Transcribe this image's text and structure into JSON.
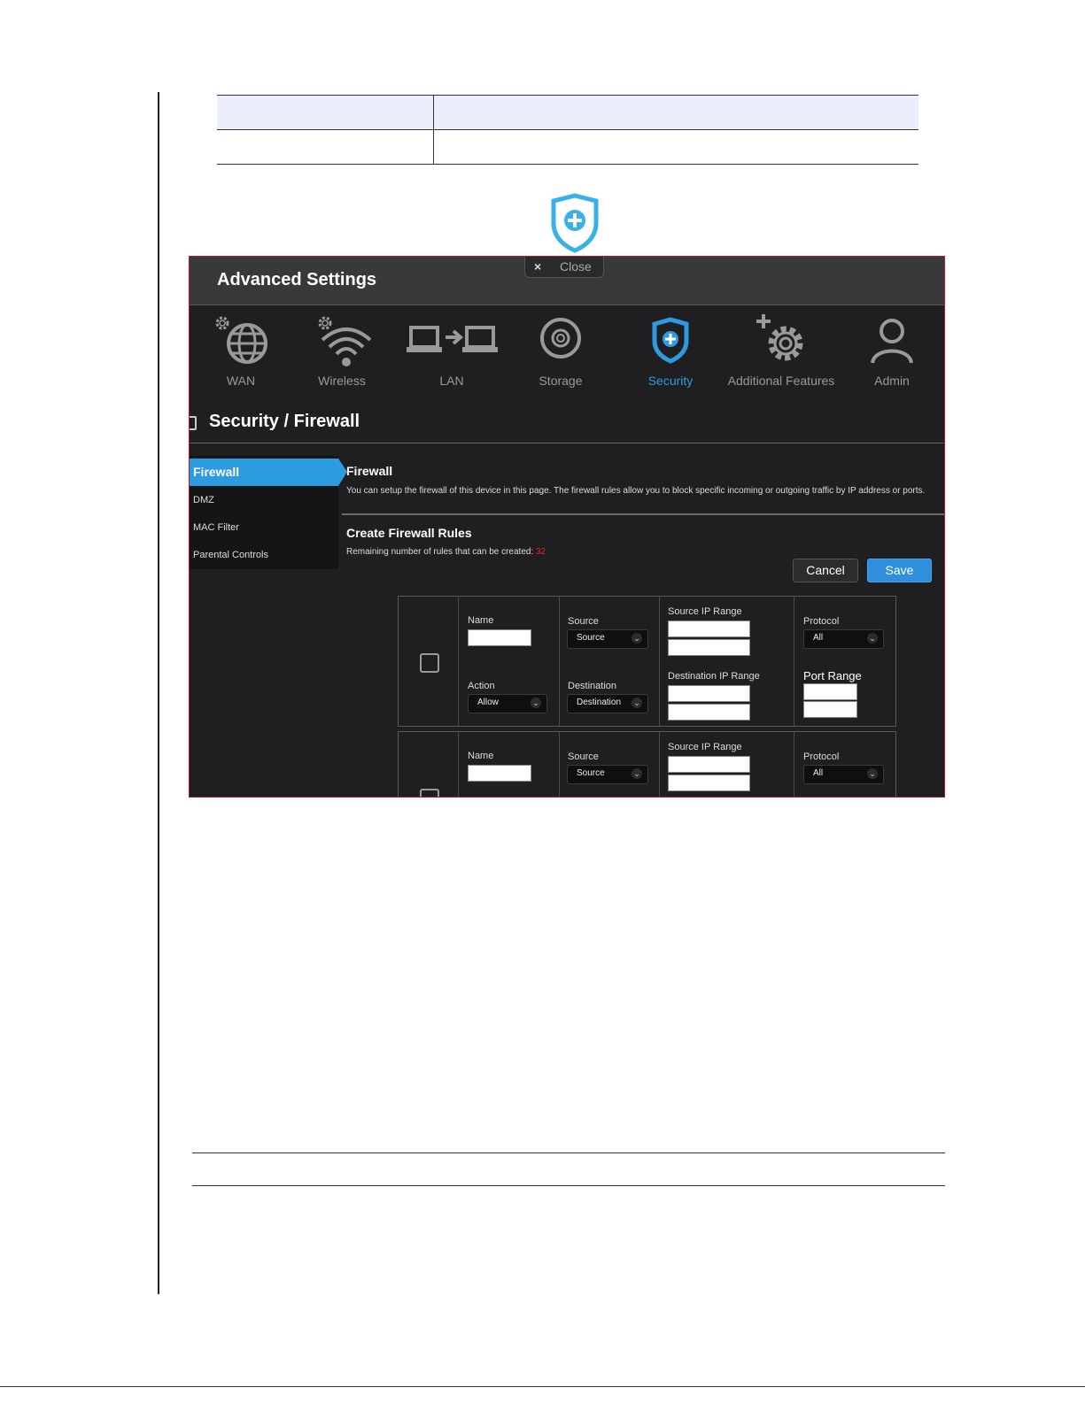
{
  "app": {
    "title": "Advanced Settings",
    "close_label": "Close",
    "close_icon": "×"
  },
  "nav": {
    "items": [
      {
        "label": "WAN",
        "icon": "globe-gear-icon"
      },
      {
        "label": "Wireless",
        "icon": "wifi-gear-icon"
      },
      {
        "label": "LAN",
        "icon": "lan-icon"
      },
      {
        "label": "Storage",
        "icon": "disc-icon"
      },
      {
        "label": "Security",
        "icon": "shield-icon",
        "active": true
      },
      {
        "label": "Additional Features",
        "icon": "gear-plus-icon"
      },
      {
        "label": "Admin",
        "icon": "user-icon"
      }
    ]
  },
  "page": {
    "heading": "Security / Firewall"
  },
  "sidebar": {
    "items": [
      {
        "label": "Firewall",
        "active": true
      },
      {
        "label": "DMZ"
      },
      {
        "label": "MAC Filter"
      },
      {
        "label": "Parental Controls"
      }
    ]
  },
  "firewall": {
    "title": "Firewall",
    "description": "You can setup the firewall of this device in this page. The firewall rules allow you to block specific incoming or outgoing traffic by IP address or ports.",
    "rules_title": "Create Firewall Rules",
    "remaining_label": "Remaining number of rules that can be created:",
    "remaining_count": "32",
    "cancel_label": "Cancel",
    "save_label": "Save"
  },
  "rule_form": {
    "name_label": "Name",
    "source_label": "Source",
    "source_value": "Source",
    "source_ip_label": "Source IP Range",
    "protocol_label": "Protocol",
    "protocol_value": "All",
    "action_label": "Action",
    "action_value": "Allow",
    "destination_label": "Destination",
    "destination_value": "Destination",
    "destination_ip_label": "Destination IP Range",
    "port_range_label": "Port Range"
  },
  "colors": {
    "accent": "#2d9be0",
    "count": "#e0242b",
    "background": "#1f1f21",
    "header": "#39393b",
    "frame": "#c0141b"
  }
}
